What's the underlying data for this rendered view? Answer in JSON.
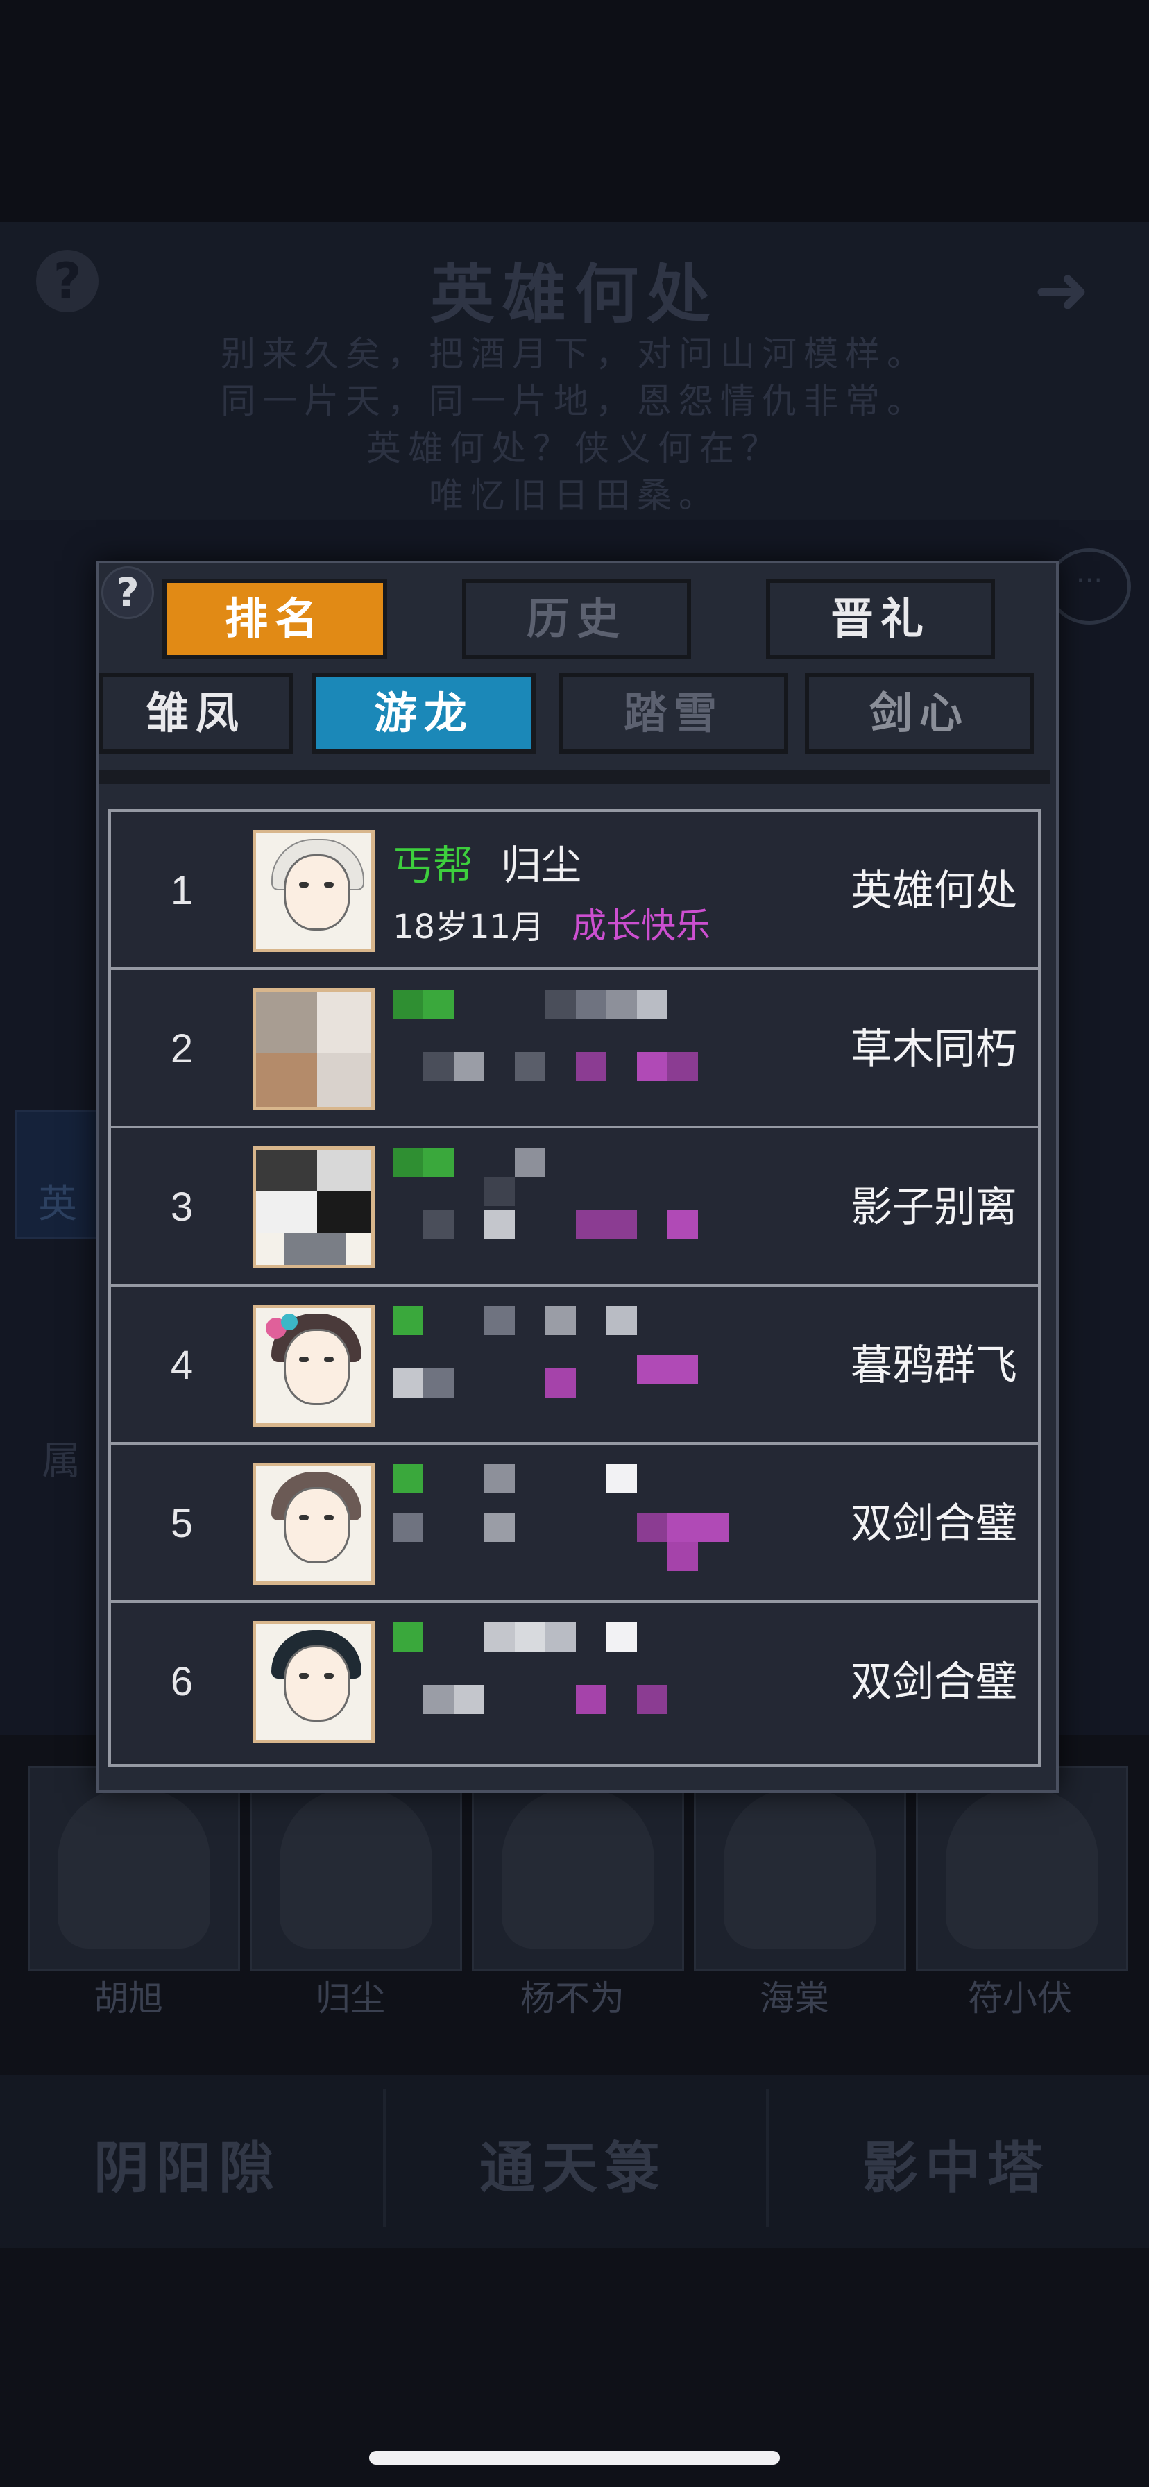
{
  "background": {
    "title": "英雄何处",
    "poem": [
      "别来久矣，把酒月下，对问山河模样。",
      "同一片天，同一片地，恩怨情仇非常。",
      "英雄何处？侠义何在？",
      "唯忆旧日田桑。"
    ],
    "side_tab": "英",
    "attr_label": "属",
    "portraits": [
      "胡旭",
      "归尘",
      "杨不为",
      "海棠",
      "符小伏"
    ],
    "bottom_buttons": [
      "阴阳隙",
      "通天箓",
      "影中塔"
    ]
  },
  "modal": {
    "help": "?",
    "tabs_top": [
      "排名",
      "历史",
      "晋礼"
    ],
    "tabs_bottom": [
      "雏凤",
      "游龙",
      "踏雪",
      "剑心"
    ],
    "active_top": "排名",
    "active_bottom": "游龙"
  },
  "ranking": [
    {
      "rank": "1",
      "sect": "丐帮",
      "name": "归尘",
      "age": "18岁11月",
      "status": "成长快乐",
      "title": "英雄何处"
    },
    {
      "rank": "2",
      "sect": "",
      "name": "",
      "age": "",
      "status": "",
      "title": "草木同朽"
    },
    {
      "rank": "3",
      "sect": "",
      "name": "",
      "age": "",
      "status": "",
      "title": "影子别离"
    },
    {
      "rank": "4",
      "sect": "",
      "name": "",
      "age": "",
      "status": "",
      "title": "暮鸦群飞"
    },
    {
      "rank": "5",
      "sect": "",
      "name": "",
      "age": "",
      "status": "",
      "title": "双剑合璧"
    },
    {
      "rank": "6",
      "sect": "",
      "name": "",
      "age": "",
      "status": "",
      "title": "双剑合璧"
    }
  ],
  "colors": {
    "accent_orange": "#e18a15",
    "accent_blue": "#1b88b8",
    "sect_green": "#3dcf3d",
    "status_purple": "#cc4fd0"
  }
}
